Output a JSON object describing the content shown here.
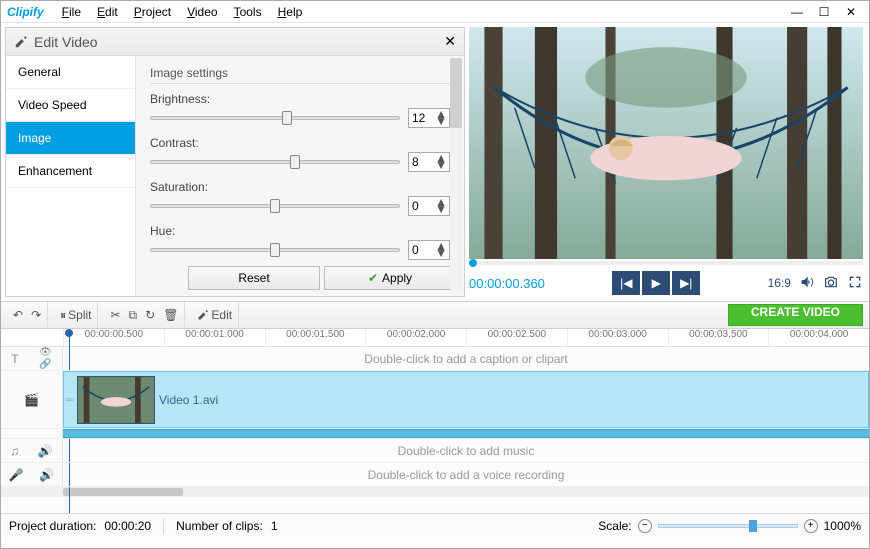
{
  "app": {
    "name": "Clipify"
  },
  "menu": [
    "File",
    "Edit",
    "Project",
    "Video",
    "Tools",
    "Help"
  ],
  "panel": {
    "title": "Edit Video",
    "tabs": [
      "General",
      "Video Speed",
      "Image",
      "Enhancement"
    ],
    "active_tab": 2,
    "section_title": "Image settings",
    "settings": [
      {
        "label": "Brightness:",
        "value": "12",
        "pos": 55
      },
      {
        "label": "Contrast:",
        "value": "8",
        "pos": 58
      },
      {
        "label": "Saturation:",
        "value": "0",
        "pos": 50
      },
      {
        "label": "Hue:",
        "value": "0",
        "pos": 50
      }
    ],
    "reset": "Reset",
    "apply": "Apply"
  },
  "preview": {
    "timecode": "00:00:00.360",
    "aspect": "16:9"
  },
  "toolbar": {
    "split": "Split",
    "edit": "Edit",
    "create": "CREATE VIDEO"
  },
  "ruler": [
    "00:00:00.500",
    "00:00:01.000",
    "00:00:01.500",
    "00:00:02.000",
    "00:00:02.500",
    "00:00:03.000",
    "00:00:03.500",
    "00:00:04.000"
  ],
  "tracks": {
    "caption_hint": "Double-click to add a caption or clipart",
    "video_clip": "Video 1.avi",
    "music_hint": "Double-click to add music",
    "voice_hint": "Double-click to add a voice recording"
  },
  "status": {
    "duration_label": "Project duration:",
    "duration": "00:00:20",
    "clips_label": "Number of clips:",
    "clips": "1",
    "scale_label": "Scale:",
    "zoom": "1000%"
  }
}
